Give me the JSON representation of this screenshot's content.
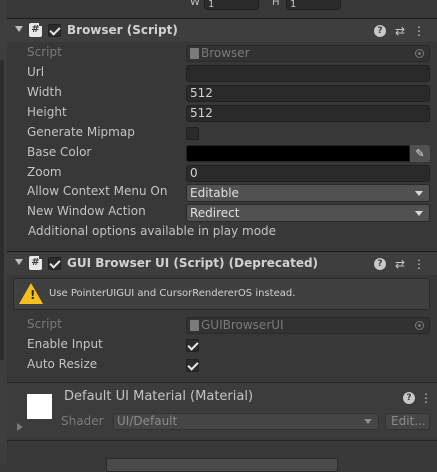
{
  "top": {
    "w_label": "W",
    "w_value": "1",
    "h_label": "H",
    "h_value": "1"
  },
  "browser": {
    "title": "Browser (Script)",
    "script_label": "Script",
    "script_value": "Browser",
    "url_label": "Url",
    "url_value": "",
    "width_label": "Width",
    "width_value": "512",
    "height_label": "Height",
    "height_value": "512",
    "mipmap_label": "Generate Mipmap",
    "mipmap_checked": false,
    "basecolor_label": "Base Color",
    "basecolor_value": "#000000",
    "zoom_label": "Zoom",
    "zoom_value": "0",
    "ctxmenu_label": "Allow Context Menu On",
    "ctxmenu_value": "Editable",
    "newwin_label": "New Window Action",
    "newwin_value": "Redirect",
    "info": "Additional options available in play mode"
  },
  "gui": {
    "title": "GUI Browser UI (Script) (Deprecated)",
    "warning": "Use PointerUIGUI and CursorRendererOS instead.",
    "script_label": "Script",
    "script_value": "GUIBrowserUI",
    "enable_input_label": "Enable Input",
    "enable_input_checked": true,
    "auto_resize_label": "Auto Resize",
    "auto_resize_checked": true
  },
  "material": {
    "title": "Default UI Material (Material)",
    "shader_label": "Shader",
    "shader_value": "UI/Default",
    "edit_label": "Edit..."
  },
  "icons": {
    "help": "?",
    "presets": "⇄",
    "menu": "⋮",
    "warning": "!",
    "picker": "✎"
  },
  "colors": {
    "warning": "#f4c020",
    "swatch": "#ffffff"
  }
}
